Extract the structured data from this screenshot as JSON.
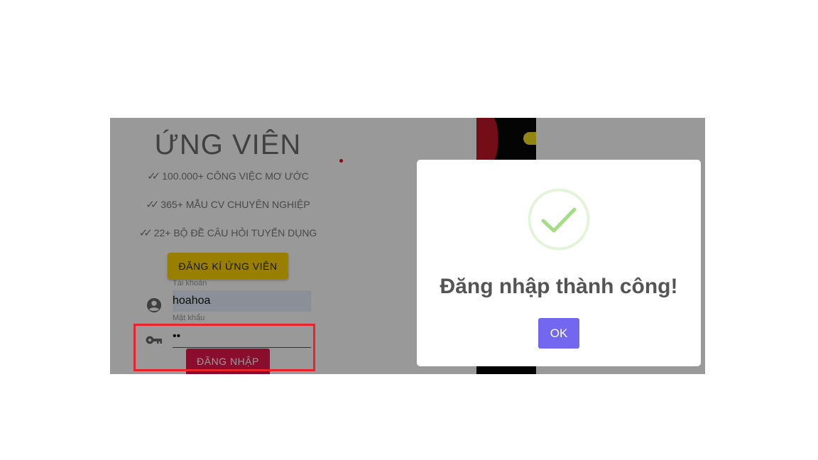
{
  "candidate": {
    "title": "ỨNG VIÊN",
    "features": [
      "100.000+ CÔNG VIỆC MƠ ƯỚC",
      "365+ MẪU CV CHUYÊN NGHIỆP",
      "22+ BỘ ĐỀ CÂU HỎI TUYỂN DỤNG"
    ],
    "register_button": "ĐĂNG KÍ ỨNG VIÊN"
  },
  "login": {
    "username_label": "Tài khoản",
    "username_value": "hoahoa",
    "password_label": "Mật khẩu",
    "password_value": "••",
    "submit_button": "ĐĂNG NHẬP"
  },
  "dialog": {
    "title": "Đăng nhập thành công!",
    "ok_button": "OK",
    "icon": "success-check-icon"
  },
  "colors": {
    "register_button": "#ffd400",
    "login_button": "#e8174d",
    "ok_button": "#7367f0",
    "success": "#a5dc86",
    "highlight": "#e8232c"
  }
}
